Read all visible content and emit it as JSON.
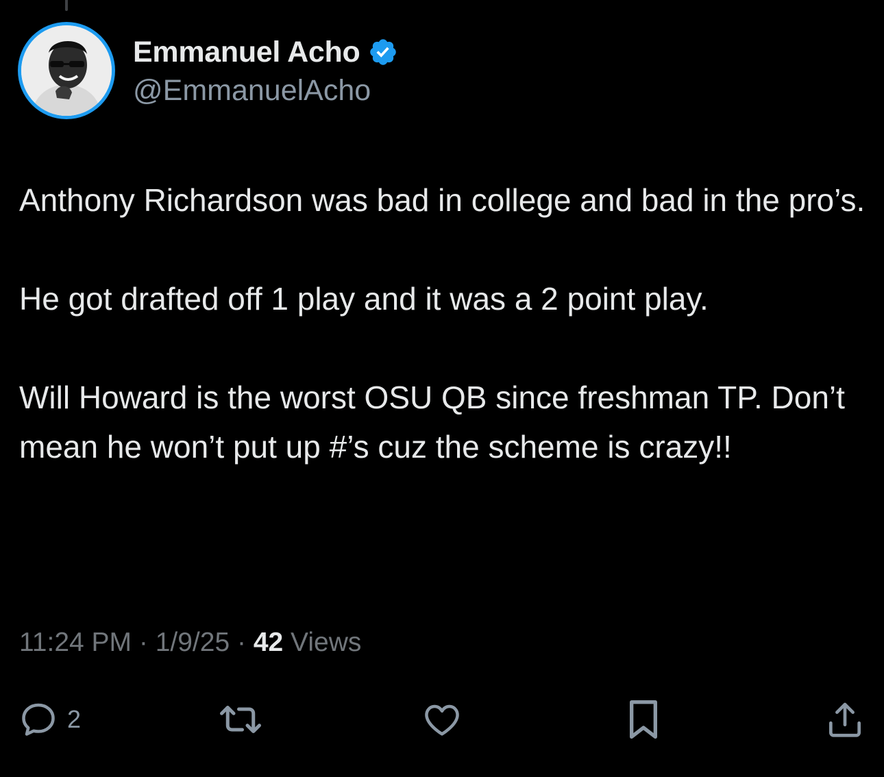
{
  "author": {
    "display_name": "Emmanuel Acho",
    "handle": "@EmmanuelAcho",
    "verified": true
  },
  "tweet": {
    "paragraphs": [
      "Anthony Richardson was bad in college and bad in the pro’s.",
      "He got drafted off 1 play and it was a 2 point play.",
      "Will Howard is the worst OSU QB since freshman TP. Don’t mean he won’t put up #’s cuz the scheme is crazy!!"
    ]
  },
  "meta": {
    "time": "11:24 PM",
    "separator": " · ",
    "date": "1/9/25",
    "views_count": "42",
    "views_label": " Views"
  },
  "actions": {
    "reply_count": "2"
  },
  "colors": {
    "background": "#000000",
    "text": "#e7e9ea",
    "secondary": "#71767b",
    "verified": "#1d9bf0"
  },
  "icons": [
    "verified-badge-icon",
    "reply-icon",
    "retweet-icon",
    "like-icon",
    "bookmark-icon",
    "share-icon"
  ]
}
